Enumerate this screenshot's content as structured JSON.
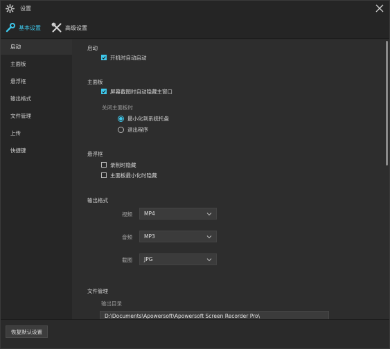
{
  "window": {
    "title": "设置"
  },
  "tabs": [
    {
      "label": "基本设置",
      "icon": "wrench-icon",
      "active": true
    },
    {
      "label": "高级设置",
      "icon": "tools-icon",
      "active": false
    }
  ],
  "sidebar": {
    "items": [
      {
        "label": "启动",
        "active": true
      },
      {
        "label": "主面板"
      },
      {
        "label": "悬浮框"
      },
      {
        "label": "输出格式"
      },
      {
        "label": "文件管理"
      },
      {
        "label": "上传"
      },
      {
        "label": "快捷键"
      }
    ]
  },
  "startup": {
    "title": "启动",
    "auto_start": {
      "label": "开机时自动启动",
      "checked": true
    }
  },
  "panel": {
    "title": "主面板",
    "hide_on_screenshot": {
      "label": "屏幕截图时自动隐藏主窗口",
      "checked": true
    },
    "close_title": "关闭主面板时",
    "minimize_tray": {
      "label": "最小化到系统托盘",
      "selected": true
    },
    "exit_app": {
      "label": "退出程序",
      "selected": false
    }
  },
  "floating": {
    "title": "悬浮框",
    "hide_recording": {
      "label": "录制时隐藏",
      "checked": false
    },
    "hide_minimized": {
      "label": "主面板最小化时隐藏",
      "checked": false
    }
  },
  "output": {
    "title": "输出格式",
    "video": {
      "label": "视频",
      "value": "MP4"
    },
    "audio": {
      "label": "音频",
      "value": "MP3"
    },
    "screenshot": {
      "label": "截图",
      "value": "JPG"
    }
  },
  "files": {
    "title": "文件管理",
    "output_dir_label": "输出目录",
    "output_dir_value": "D:\\Documents\\Apowersoft\\Apowersoft Screen Recorder Pro\\"
  },
  "footer": {
    "reset_label": "恢复默认设置"
  },
  "colors": {
    "accent": "#3ec7ea",
    "background": "#2d2d2d",
    "sidebar": "#262626"
  }
}
